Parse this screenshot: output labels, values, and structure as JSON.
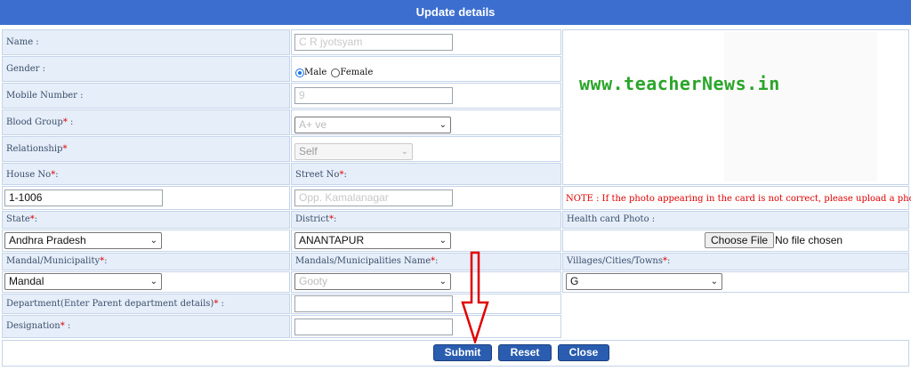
{
  "header": {
    "title": "Update details"
  },
  "fields": {
    "name": {
      "label": "Name :",
      "value": "C R       jyotsyam"
    },
    "gender": {
      "label": "Gender :",
      "options": [
        "Male",
        "Female"
      ],
      "selected": "Male"
    },
    "mobile": {
      "label": "Mobile Number :",
      "value": "9"
    },
    "blood_group": {
      "label": "Blood Group",
      "required_mark": "*",
      "suffix": " :",
      "value": "A+ ve"
    },
    "relationship": {
      "label": "Relationship",
      "required_mark": "*",
      "value": "Self"
    },
    "house_no": {
      "label": "House No",
      "required_mark": "*",
      "suffix": ":",
      "value": "1-1006"
    },
    "street_no": {
      "label": "Street No",
      "required_mark": "*",
      "suffix": ":",
      "value": "Opp. Kamalanagar"
    },
    "state": {
      "label": "State",
      "required_mark": "*",
      "suffix": ":",
      "value": "Andhra Pradesh"
    },
    "district": {
      "label": "District",
      "required_mark": "*",
      "suffix": ":",
      "value": "ANANTAPUR"
    },
    "health_card_photo": {
      "label": "Health card Photo :",
      "button": "Choose File",
      "status": "No file chosen"
    },
    "mandal_municipality": {
      "label": "Mandal/Municipality",
      "required_mark": "*",
      "suffix": ":",
      "value": "Mandal"
    },
    "mandals_name": {
      "label": "Mandals/Municipalities Name",
      "required_mark": "*",
      "suffix": ":",
      "value": "Gooty"
    },
    "villages": {
      "label": "Villages/Cities/Towns",
      "required_mark": "*",
      "suffix": ":",
      "value": "G"
    },
    "department": {
      "label": "Department(Enter Parent department details)",
      "required_mark": "*",
      "suffix": " :",
      "value": ""
    },
    "designation": {
      "label": "Designation",
      "required_mark": "*",
      "suffix": " :",
      "value": ""
    }
  },
  "photo": {
    "watermark": "www.teacherNews.in",
    "note": "NOTE : If the photo appearing in the card is not correct, please upload a photo."
  },
  "buttons": {
    "submit": "Submit",
    "reset": "Reset",
    "close": "Close"
  },
  "colors": {
    "header": "#3c6ecf",
    "label_bg": "#e6eefa",
    "button": "#2a5db0",
    "required": "#dd0000",
    "annotation_arrow": "#e00000",
    "watermark": "#2aa52a"
  }
}
